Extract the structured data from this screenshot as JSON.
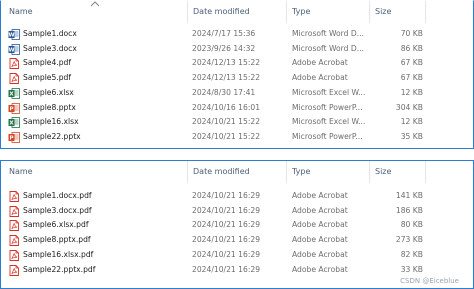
{
  "columns": {
    "name": "Name",
    "date": "Date modified",
    "type": "Type",
    "size": "Size"
  },
  "top_files": [
    {
      "name": "Sample1.docx",
      "date": "2024/7/17 15:36",
      "type": "Microsoft Word D...",
      "size": "70 KB",
      "icon": "word-icon"
    },
    {
      "name": "Sample3.docx",
      "date": "2023/9/26 14:32",
      "type": "Microsoft Word D...",
      "size": "86 KB",
      "icon": "word-icon"
    },
    {
      "name": "Sample4.pdf",
      "date": "2024/12/13 15:22",
      "type": "Adobe Acrobat",
      "size": "67 KB",
      "icon": "pdf-icon"
    },
    {
      "name": "Sample5.pdf",
      "date": "2024/12/13 15:22",
      "type": "Adobe Acrobat",
      "size": "67 KB",
      "icon": "pdf-icon"
    },
    {
      "name": "Sample6.xlsx",
      "date": "2024/8/30 17:41",
      "type": "Microsoft Excel W...",
      "size": "12 KB",
      "icon": "excel-icon"
    },
    {
      "name": "Sample8.pptx",
      "date": "2024/10/16 16:01",
      "type": "Microsoft PowerP...",
      "size": "304 KB",
      "icon": "powerpoint-icon"
    },
    {
      "name": "Sample16.xlsx",
      "date": "2024/10/21 15:22",
      "type": "Microsoft Excel W...",
      "size": "12 KB",
      "icon": "excel-icon"
    },
    {
      "name": "Sample22.pptx",
      "date": "2024/10/21 15:22",
      "type": "Microsoft PowerP...",
      "size": "35 KB",
      "icon": "powerpoint-icon"
    }
  ],
  "bottom_files": [
    {
      "name": "Sample1.docx.pdf",
      "date": "2024/10/21 16:29",
      "type": "Adobe Acrobat",
      "size": "141 KB",
      "icon": "pdf-icon"
    },
    {
      "name": "Sample3.docx.pdf",
      "date": "2024/10/21 16:29",
      "type": "Adobe Acrobat",
      "size": "186 KB",
      "icon": "pdf-icon"
    },
    {
      "name": "Sample6.xlsx.pdf",
      "date": "2024/10/21 16:29",
      "type": "Adobe Acrobat",
      "size": "80 KB",
      "icon": "pdf-icon"
    },
    {
      "name": "Sample8.pptx.pdf",
      "date": "2024/10/21 16:29",
      "type": "Adobe Acrobat",
      "size": "273 KB",
      "icon": "pdf-icon"
    },
    {
      "name": "Sample16.xlsx.pdf",
      "date": "2024/10/21 16:29",
      "type": "Adobe Acrobat",
      "size": "82 KB",
      "icon": "pdf-icon"
    },
    {
      "name": "Sample22.pptx.pdf",
      "date": "2024/10/21 16:29",
      "type": "Adobe Acrobat",
      "size": "33 KB",
      "icon": "pdf-icon"
    }
  ],
  "watermark": "CSDN @Eiceblue",
  "colors": {
    "selection_border": "#2a7fd4",
    "word": "#2b579a",
    "excel": "#217346",
    "powerpoint": "#d24726",
    "pdf": "#d93025"
  }
}
